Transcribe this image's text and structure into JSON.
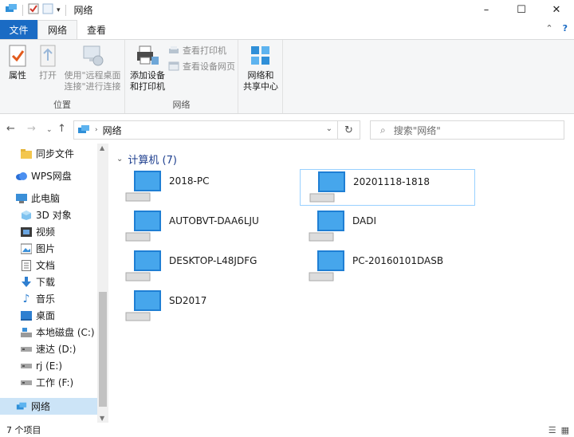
{
  "window": {
    "title": "网络",
    "minimize_icon": "–",
    "maximize_icon": "☐",
    "close_icon": "✕"
  },
  "tabs": {
    "file": "文件",
    "network": "网络",
    "view": "查看"
  },
  "ribbon": {
    "location_group": "位置",
    "network_group": "网络",
    "properties": "属性",
    "open": "打开",
    "remote_desktop_line1": "使用\"远程桌面",
    "remote_desktop_line2": "连接\"进行连接",
    "add_devices_line1": "添加设备",
    "add_devices_line2": "和打印机",
    "view_printers": "查看打印机",
    "view_device_webpage": "查看设备网页",
    "network_center_line1": "网络和",
    "network_center_line2": "共享中心"
  },
  "address": {
    "crumb": "网络",
    "search_placeholder": "搜索\"网络\""
  },
  "nav": {
    "items": [
      {
        "label": "同步文件"
      },
      {
        "label": "WPS网盘"
      },
      {
        "label": "此电脑"
      },
      {
        "label": "3D 对象"
      },
      {
        "label": "视频"
      },
      {
        "label": "图片"
      },
      {
        "label": "文档"
      },
      {
        "label": "下载"
      },
      {
        "label": "音乐"
      },
      {
        "label": "桌面"
      },
      {
        "label": "本地磁盘 (C:)"
      },
      {
        "label": "速达 (D:)"
      },
      {
        "label": "rj (E:)"
      },
      {
        "label": "工作 (F:)"
      },
      {
        "label": "网络"
      }
    ]
  },
  "content": {
    "group_header": "计算机 (7)",
    "computers": [
      {
        "name": "2018-PC"
      },
      {
        "name": "20201118-1818"
      },
      {
        "name": "AUTOBVT-DAA6LJU"
      },
      {
        "name": "DADI"
      },
      {
        "name": "DESKTOP-L48JDFG"
      },
      {
        "name": "PC-20160101DASB"
      },
      {
        "name": "SD2017"
      }
    ]
  },
  "status": {
    "count": "7 个项目"
  }
}
